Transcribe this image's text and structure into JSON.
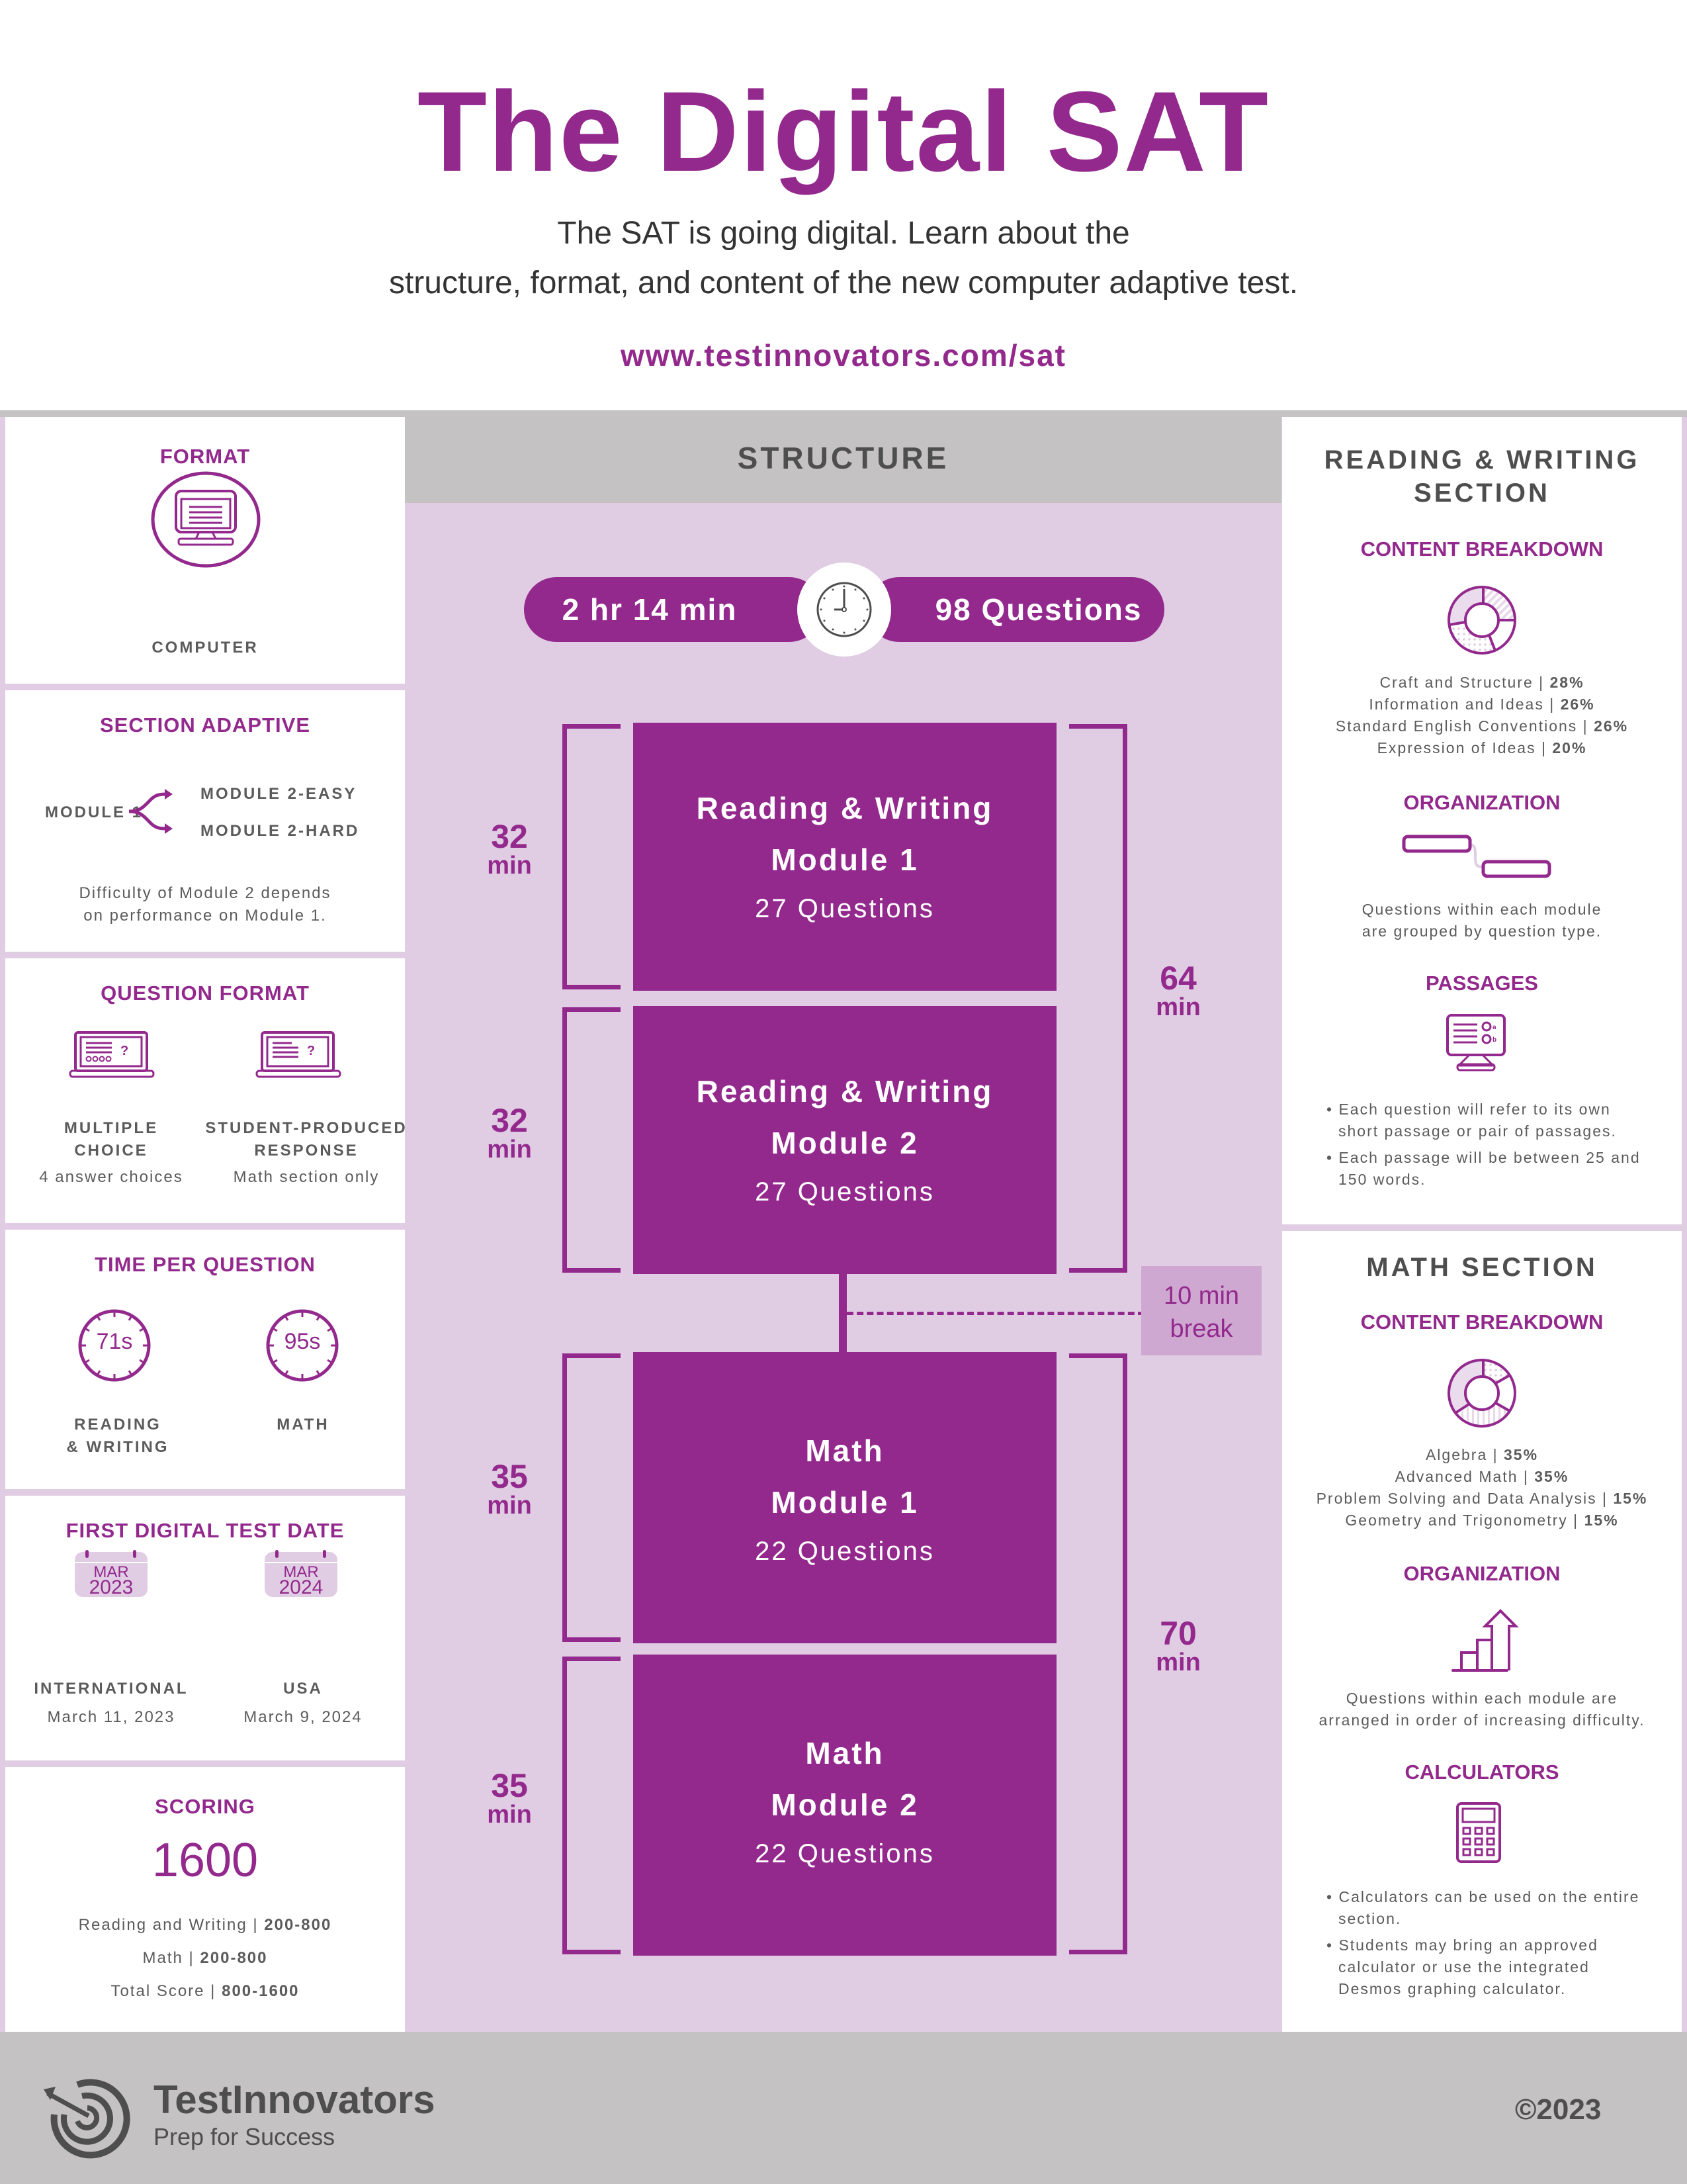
{
  "header": {
    "title": "The Digital SAT",
    "subtitle_line1": "The SAT is going digital. Learn about the",
    "subtitle_line2": "structure, format, and content of the new computer adaptive test.",
    "url": "www.testinnovators.com/sat"
  },
  "colors": {
    "accent": "#93298d",
    "light_accent": "#e0cde3",
    "gray": "#c4c2c3",
    "dark_text": "#4e4e4e"
  },
  "format": {
    "title": "FORMAT",
    "icon": "computer-icon",
    "label": "COMPUTER"
  },
  "section_adaptive": {
    "title": "SECTION ADAPTIVE",
    "module1": "MODULE 1",
    "module2_easy": "MODULE 2-EASY",
    "module2_hard": "MODULE 2-HARD",
    "note_line1": "Difficulty of Module 2 depends",
    "note_line2": "on performance on Module 1."
  },
  "question_format": {
    "title": "QUESTION FORMAT",
    "items": [
      {
        "label_line1": "MULTIPLE",
        "label_line2": "CHOICE",
        "detail": "4 answer choices",
        "icon": "laptop-multiple-choice-icon"
      },
      {
        "label_line1": "STUDENT-PRODUCED",
        "label_line2": "RESPONSE",
        "detail": "Math section only",
        "icon": "laptop-response-icon"
      }
    ]
  },
  "time_per_question": {
    "title": "TIME PER QUESTION",
    "items": [
      {
        "value": "71s",
        "label_line1": "READING",
        "label_line2": "& WRITING"
      },
      {
        "value": "95s",
        "label_line1": "MATH",
        "label_line2": ""
      }
    ]
  },
  "first_test_date": {
    "title": "FIRST DIGITAL TEST DATE",
    "items": [
      {
        "month": "MAR",
        "year": "2023",
        "region": "INTERNATIONAL",
        "date": "March 11, 2023"
      },
      {
        "month": "MAR",
        "year": "2024",
        "region": "USA",
        "date": "March 9, 2024"
      }
    ]
  },
  "scoring": {
    "title": "SCORING",
    "total": "1600",
    "rows": [
      {
        "label": "Reading and Writing",
        "range": "200-800"
      },
      {
        "label": "Math",
        "range": "200-800"
      },
      {
        "label": "Total Score",
        "range": "800-1600"
      }
    ]
  },
  "structure": {
    "title": "STRUCTURE",
    "total_time": "2 hr 14 min",
    "total_questions": "98 Questions",
    "modules": [
      {
        "title_line1": "Reading & Writing",
        "title_line2": "Module 1",
        "questions": "27 Questions",
        "time": "32",
        "unit": "min"
      },
      {
        "title_line1": "Reading & Writing",
        "title_line2": "Module 2",
        "questions": "27 Questions",
        "time": "32",
        "unit": "min"
      },
      {
        "title_line1": "Math",
        "title_line2": "Module 1",
        "questions": "22 Questions",
        "time": "35",
        "unit": "min"
      },
      {
        "title_line1": "Math",
        "title_line2": "Module 2",
        "questions": "22 Questions",
        "time": "35",
        "unit": "min"
      }
    ],
    "section_totals": [
      {
        "time": "64",
        "unit": "min"
      },
      {
        "time": "70",
        "unit": "min"
      }
    ],
    "break_line1": "10 min",
    "break_line2": "break"
  },
  "reading_writing": {
    "title_line1": "READING & WRITING",
    "title_line2": "SECTION",
    "content_title": "CONTENT BREAKDOWN",
    "breakdown": [
      {
        "label": "Craft and Structure",
        "value": "28%"
      },
      {
        "label": "Information and Ideas",
        "value": "26%"
      },
      {
        "label": "Standard English Conventions",
        "value": "26%"
      },
      {
        "label": "Expression of Ideas",
        "value": "20%"
      }
    ],
    "organization_title": "ORGANIZATION",
    "organization_line1": "Questions within each module",
    "organization_line2": "are grouped by question type.",
    "passages_title": "PASSAGES",
    "passages": [
      "Each question will refer to its own short passage or pair of passages.",
      "Each passage will be between 25 and 150 words."
    ]
  },
  "math": {
    "title": "MATH SECTION",
    "content_title": "CONTENT BREAKDOWN",
    "breakdown": [
      {
        "label": "Algebra",
        "value": "35%"
      },
      {
        "label": "Advanced Math",
        "value": "35%"
      },
      {
        "label": "Problem Solving and Data Analysis",
        "value": "15%"
      },
      {
        "label": "Geometry and Trigonometry",
        "value": "15%"
      }
    ],
    "organization_title": "ORGANIZATION",
    "organization_line1": "Questions within each module are",
    "organization_line2": "arranged in order of increasing difficulty.",
    "calculators_title": "CALCULATORS",
    "calculators": [
      "Calculators can be used on the entire section.",
      "Students may bring an approved calculator or use the integrated Desmos graphing calculator."
    ]
  },
  "footer": {
    "brand": "TestInnovators",
    "tagline": "Prep for Success",
    "copyright": "©2023"
  }
}
